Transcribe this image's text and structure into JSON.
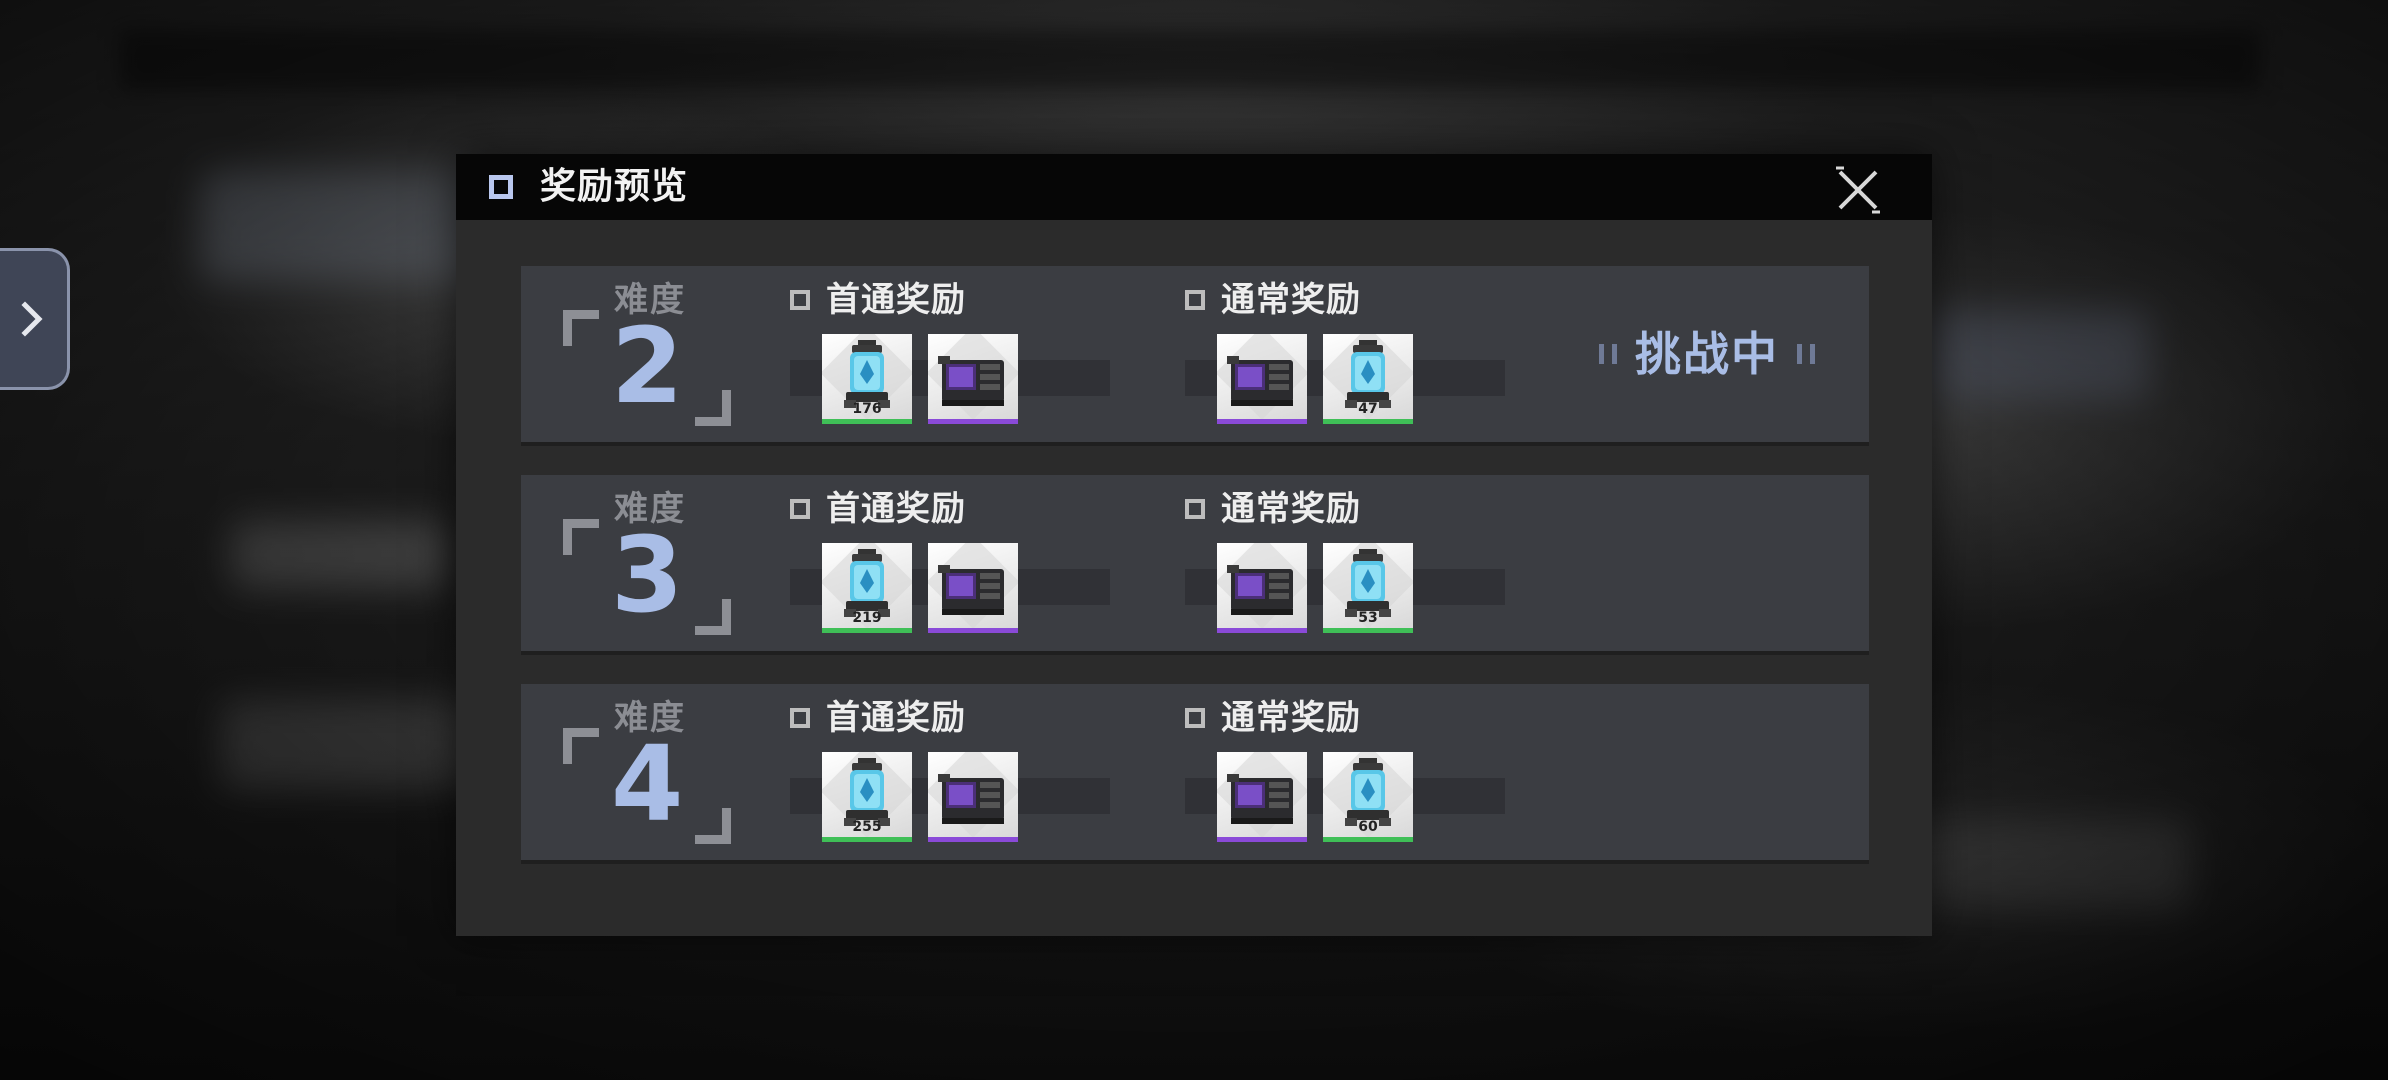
{
  "dialog": {
    "title": "奖励预览"
  },
  "rows": [
    {
      "difficulty_label": "难度",
      "difficulty_value": "2",
      "status": "挑战中",
      "first_clear": {
        "label": "首通奖励",
        "items": [
          {
            "icon": "blue-capsule-icon",
            "count": "176",
            "rarity": "green"
          },
          {
            "icon": "purple-device-icon",
            "count": "",
            "rarity": "purple"
          }
        ]
      },
      "regular": {
        "label": "通常奖励",
        "items": [
          {
            "icon": "purple-device-icon",
            "count": "",
            "rarity": "purple"
          },
          {
            "icon": "blue-capsule-icon",
            "count": "47",
            "rarity": "green"
          }
        ]
      }
    },
    {
      "difficulty_label": "难度",
      "difficulty_value": "3",
      "first_clear": {
        "label": "首通奖励",
        "items": [
          {
            "icon": "blue-capsule-icon",
            "count": "219",
            "rarity": "green"
          },
          {
            "icon": "purple-device-icon",
            "count": "",
            "rarity": "purple"
          }
        ]
      },
      "regular": {
        "label": "通常奖励",
        "items": [
          {
            "icon": "purple-device-icon",
            "count": "",
            "rarity": "purple"
          },
          {
            "icon": "blue-capsule-icon",
            "count": "53",
            "rarity": "green"
          }
        ]
      }
    },
    {
      "difficulty_label": "难度",
      "difficulty_value": "4",
      "first_clear": {
        "label": "首通奖励",
        "items": [
          {
            "icon": "blue-capsule-icon",
            "count": "255",
            "rarity": "green"
          },
          {
            "icon": "purple-device-icon",
            "count": "",
            "rarity": "purple"
          }
        ]
      },
      "regular": {
        "label": "通常奖励",
        "items": [
          {
            "icon": "purple-device-icon",
            "count": "",
            "rarity": "purple"
          },
          {
            "icon": "blue-capsule-icon",
            "count": "60",
            "rarity": "green"
          }
        ]
      }
    }
  ],
  "colors": {
    "accent_blue": "#a9bde6",
    "rarity_green": "#3fbf57",
    "rarity_purple": "#8a4ad8"
  }
}
